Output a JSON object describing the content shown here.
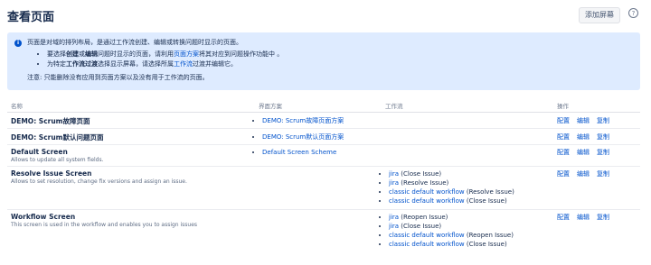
{
  "header": {
    "title": "查看页面",
    "add_button": "添加屏幕",
    "help_glyph": "?"
  },
  "info": {
    "icon_glyph": "i",
    "line1": "页面是对域的排列布局，是通过工作流创建、编辑或转换问题时显示的页面。",
    "bullet1": {
      "pre": "要选择",
      "b1": "创建",
      "mid1": "或",
      "b2": "编辑",
      "mid2": "问题时显示的页面，请利用",
      "link": "页面方案",
      "post": "将其对应到问题操作功能中 。"
    },
    "bullet2": {
      "pre": "为特定",
      "b1": "工作流过渡",
      "mid": "选择显示屏幕，请选择所属",
      "link": "工作流",
      "post": "过渡并编辑它。"
    },
    "note": "注意: 只能删除没有应用到页面方案以及没有用于工作流的页面。"
  },
  "table": {
    "headers": {
      "name": "名称",
      "scheme": "界面方案",
      "workflow": "工作流",
      "ops": "操作"
    },
    "op_labels": {
      "config": "配置",
      "edit": "编辑",
      "copy": "复制"
    },
    "rows": [
      {
        "name": "DEMO: Scrum故障页面",
        "desc": "",
        "schemes": [
          "DEMO: Scrum故障页面方案"
        ],
        "workflows": []
      },
      {
        "name": "DEMO: Scrum默认问题页面",
        "desc": "",
        "schemes": [
          "DEMO: Scrum默认页面方案"
        ],
        "workflows": []
      },
      {
        "name": "Default Screen",
        "desc": "Allows to update all system fields.",
        "schemes": [
          "Default Screen Scheme"
        ],
        "workflows": []
      },
      {
        "name": "Resolve Issue Screen",
        "desc": "Allows to set resolution, change fix versions and assign an issue.",
        "schemes": [],
        "workflows": [
          {
            "link": "jira",
            "action": "(Close Issue)"
          },
          {
            "link": "jira",
            "action": "(Resolve Issue)"
          },
          {
            "link": "classic default workflow",
            "action": "(Resolve Issue)"
          },
          {
            "link": "classic default workflow",
            "action": "(Close Issue)"
          }
        ]
      },
      {
        "name": "Workflow Screen",
        "desc": "This screen is used in the workflow and enables you to assign issues",
        "schemes": [],
        "workflows": [
          {
            "link": "jira",
            "action": "(Reopen Issue)"
          },
          {
            "link": "jira",
            "action": "(Close Issue)"
          },
          {
            "link": "classic default workflow",
            "action": "(Reopen Issue)"
          },
          {
            "link": "classic default workflow",
            "action": "(Close Issue)"
          }
        ]
      }
    ]
  },
  "colors": {
    "info_bg": "#deebff",
    "link": "#0052cc",
    "text": "#172b4d"
  }
}
